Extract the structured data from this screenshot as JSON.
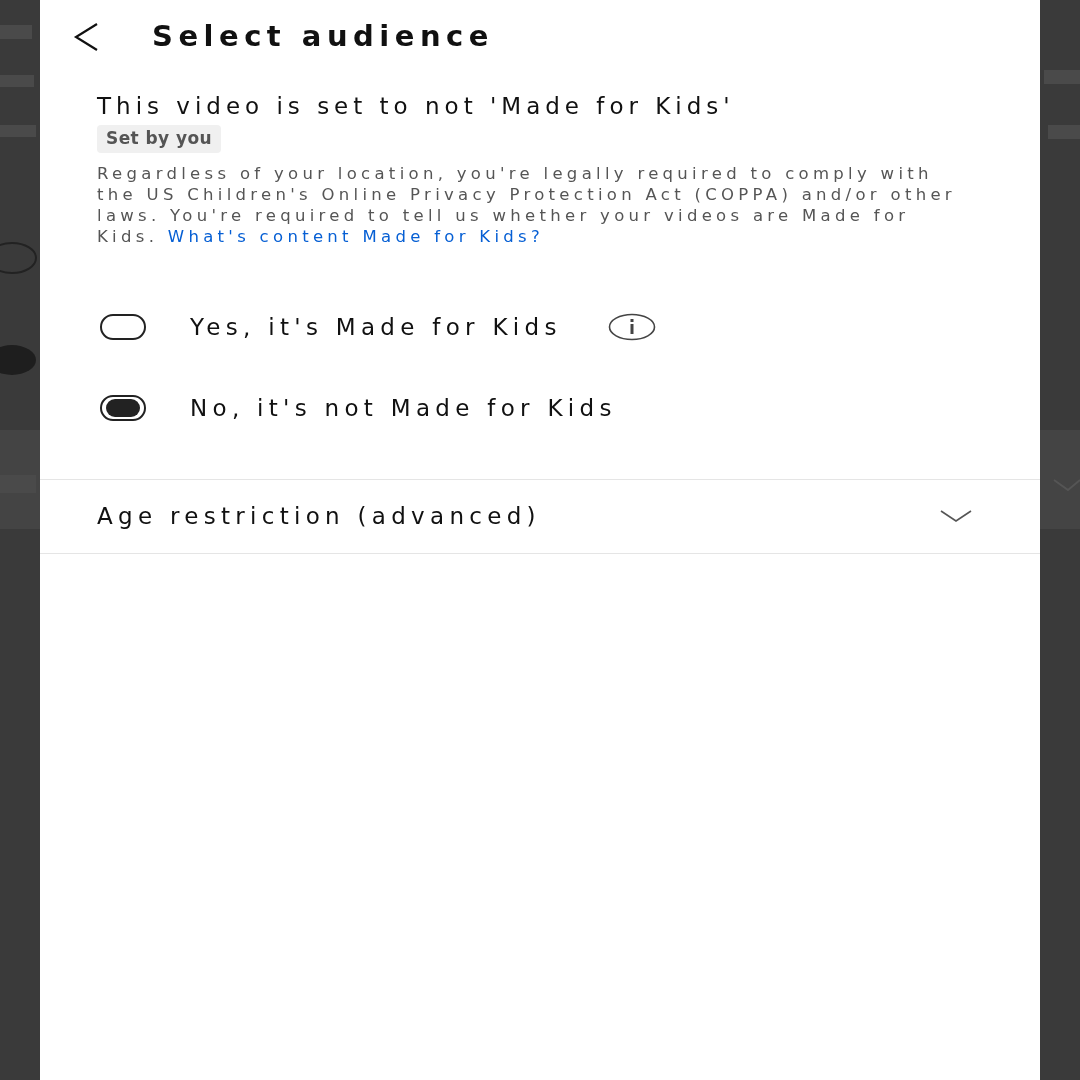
{
  "header": {
    "title": "Select audience"
  },
  "status": {
    "heading": "This video is set to not 'Made for Kids'",
    "badge": "Set by you"
  },
  "notice": {
    "text": "Regardless of your location, you're legally required to comply with the US Children's Online Privacy Protection Act (COPPA) and/or other laws. You're required to tell us whether your videos are Made for Kids.",
    "link": "What's content Made for Kids?"
  },
  "options": [
    {
      "label": "Yes, it's Made for Kids",
      "selected": false,
      "info": true
    },
    {
      "label": "No, it's not Made for Kids",
      "selected": true,
      "info": false
    }
  ],
  "age_restriction": {
    "label": "Age restriction (advanced)",
    "expanded": false
  }
}
